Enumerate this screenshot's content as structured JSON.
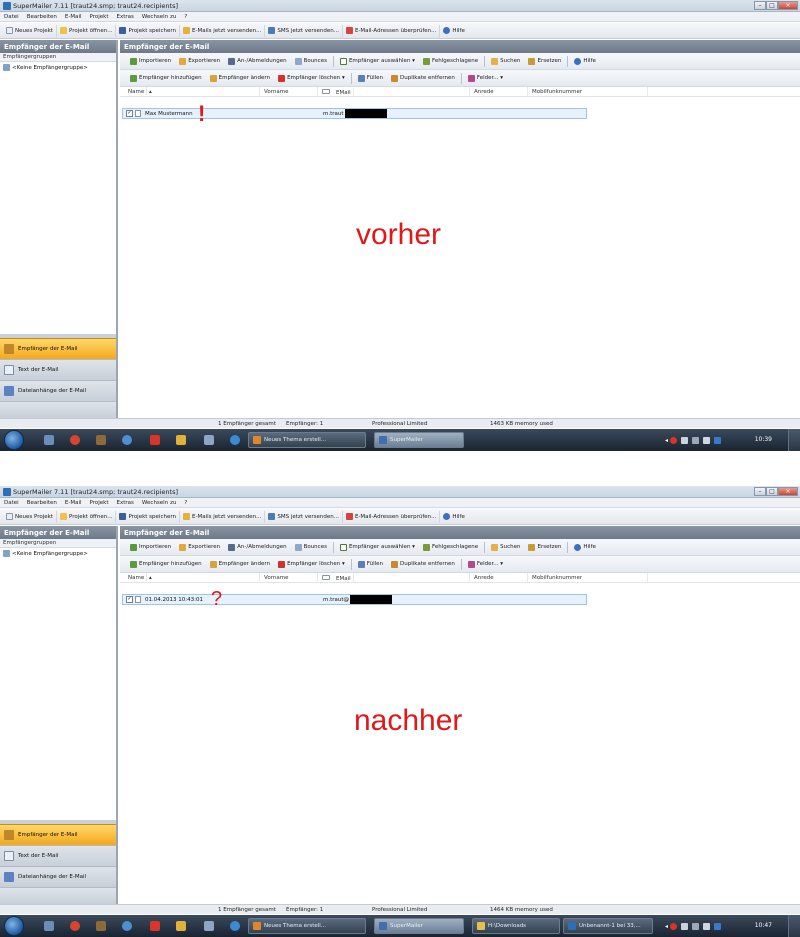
{
  "shots": [
    {
      "title": "SuperMailer 7.11 [traut24.smp; traut24.recipients]",
      "menu": [
        "Datei",
        "Bearbeiten",
        "E-Mail",
        "Projekt",
        "Extras",
        "Wechseln zu",
        "?"
      ],
      "toolbar": [
        "Neues Projekt",
        "Projekt öffnen...",
        "Projekt speichern",
        "E-Mails jetzt versenden...",
        "SMS jetzt versenden...",
        "E-Mail-Adressen überprüfen...",
        "Hilfe"
      ],
      "sidebar": {
        "header": "Empfänger der E-Mail",
        "groups_label": "Empfängergruppen",
        "group_item": "<Keine Empfängergruppe>",
        "nav": [
          "Empfänger der E-Mail",
          "Text der E-Mail",
          "Dateianhänge der E-Mail"
        ]
      },
      "main": {
        "header": "Empfänger der E-Mail",
        "tools1": [
          "Importieren",
          "Exportieren",
          "An-/Abmeldungen",
          "Bounces",
          "Empfänger auswählen",
          "Fehlgeschlagene",
          "Suchen",
          "Ersetzen",
          "Hilfe"
        ],
        "tools2": [
          "Empfänger hinzufügen",
          "Empfänger ändern",
          "Empfänger löschen",
          "Füllen",
          "Duplikate entfernen",
          "Felder..."
        ],
        "columns": [
          "Name",
          "Vorname",
          "EMail",
          "Anrede",
          "Mobilfunknummer"
        ],
        "row": {
          "name": "Max Mustermann",
          "vorname": "",
          "email": "m.traut"
        }
      },
      "annotation_mark": "!",
      "label": "vorher",
      "status": {
        "total": "1 Empfänger gesamt",
        "recipients": "Empfänger: 1",
        "edition": "Professional Limited",
        "memory": "1463 KB memory used"
      },
      "taskbar": {
        "tasks": [
          "Neues Thema erstell...",
          "SuperMailer"
        ],
        "clock": "10:39"
      }
    },
    {
      "title": "SuperMailer 7.11 [traut24.smp; traut24.recipients]",
      "menu": [
        "Datei",
        "Bearbeiten",
        "E-Mail",
        "Projekt",
        "Extras",
        "Wechseln zu",
        "?"
      ],
      "toolbar": [
        "Neues Projekt",
        "Projekt öffnen...",
        "Projekt speichern",
        "E-Mails jetzt versenden...",
        "SMS jetzt versenden...",
        "E-Mail-Adressen überprüfen...",
        "Hilfe"
      ],
      "sidebar": {
        "header": "Empfänger der E-Mail",
        "groups_label": "Empfängergruppen",
        "group_item": "<Keine Empfängergruppe>",
        "nav": [
          "Empfänger der E-Mail",
          "Text der E-Mail",
          "Dateianhänge der E-Mail"
        ]
      },
      "main": {
        "header": "Empfänger der E-Mail",
        "tools1": [
          "Importieren",
          "Exportieren",
          "An-/Abmeldungen",
          "Bounces",
          "Empfänger auswählen",
          "Fehlgeschlagene",
          "Suchen",
          "Ersetzen",
          "Hilfe"
        ],
        "tools2": [
          "Empfänger hinzufügen",
          "Empfänger ändern",
          "Empfänger löschen",
          "Füllen",
          "Duplikate entfernen",
          "Felder..."
        ],
        "columns": [
          "Name",
          "Vorname",
          "EMail",
          "Anrede",
          "Mobilfunknummer"
        ],
        "row": {
          "name": "01.04.2013 10:43:01",
          "vorname": "",
          "email": "m.traut@"
        }
      },
      "annotation_mark": "?",
      "label": "nachher",
      "status": {
        "total": "1 Empfänger gesamt",
        "recipients": "Empfänger: 1",
        "edition": "Professional Limited",
        "memory": "1464 KB memory used"
      },
      "taskbar": {
        "tasks": [
          "Neues Thema erstell...",
          "SuperMailer",
          "H:\\Downloads",
          "Unbenannt-1 bei 33,..."
        ],
        "clock": "10:47"
      }
    }
  ]
}
